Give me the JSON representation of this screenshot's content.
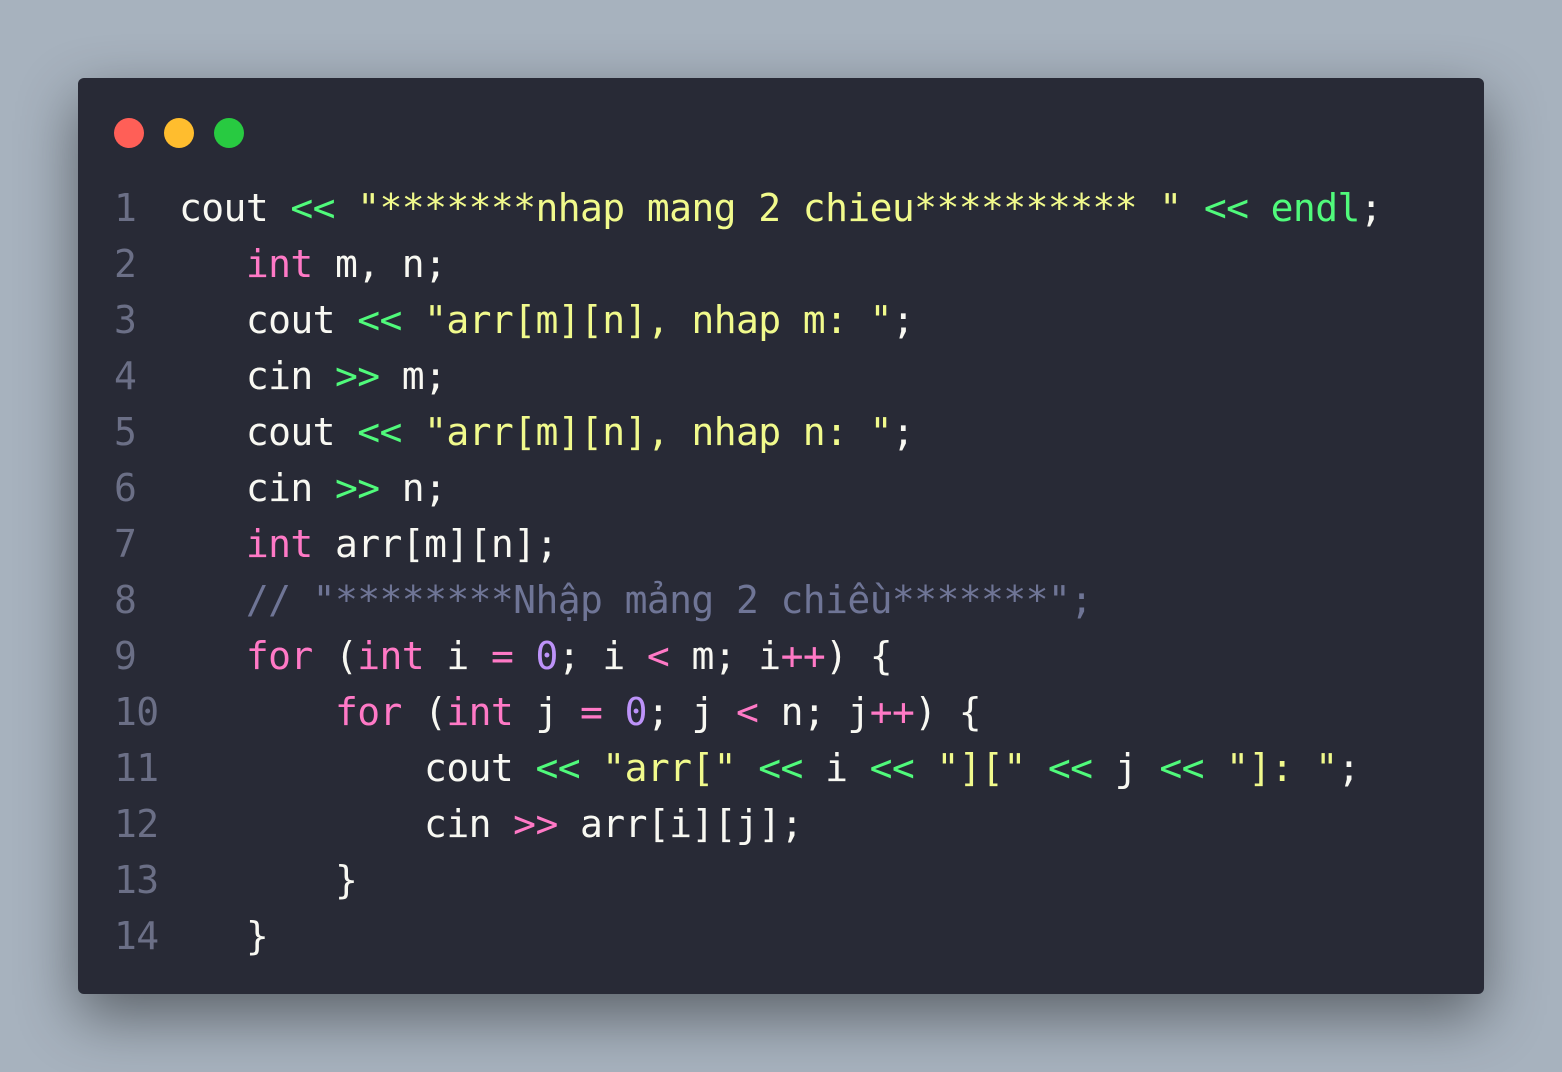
{
  "window": {
    "controls": [
      "close",
      "minimize",
      "maximize"
    ],
    "colors": {
      "close": "#ff5f57",
      "minimize": "#ffbd2e",
      "maximize": "#28ca41",
      "background": "#282a36",
      "page_background": "#a7b2be"
    }
  },
  "code": {
    "lines": [
      {
        "number": "1",
        "tokens": [
          {
            "t": "cout ",
            "c": "plain"
          },
          {
            "t": "<<",
            "c": "op"
          },
          {
            "t": " ",
            "c": "plain"
          },
          {
            "t": "\"*******nhap mang 2 chieu********** \"",
            "c": "str"
          },
          {
            "t": " ",
            "c": "plain"
          },
          {
            "t": "<<",
            "c": "op"
          },
          {
            "t": " ",
            "c": "plain"
          },
          {
            "t": "endl",
            "c": "fn"
          },
          {
            "t": ";",
            "c": "plain"
          }
        ]
      },
      {
        "number": "2",
        "tokens": [
          {
            "t": "   ",
            "c": "plain"
          },
          {
            "t": "int",
            "c": "kw"
          },
          {
            "t": " m, n;",
            "c": "plain"
          }
        ]
      },
      {
        "number": "3",
        "tokens": [
          {
            "t": "   cout ",
            "c": "plain"
          },
          {
            "t": "<<",
            "c": "op"
          },
          {
            "t": " ",
            "c": "plain"
          },
          {
            "t": "\"arr[m][n], nhap m: \"",
            "c": "str"
          },
          {
            "t": ";",
            "c": "plain"
          }
        ]
      },
      {
        "number": "4",
        "tokens": [
          {
            "t": "   cin ",
            "c": "plain"
          },
          {
            "t": ">>",
            "c": "op"
          },
          {
            "t": " m;",
            "c": "plain"
          }
        ]
      },
      {
        "number": "5",
        "tokens": [
          {
            "t": "   cout ",
            "c": "plain"
          },
          {
            "t": "<<",
            "c": "op"
          },
          {
            "t": " ",
            "c": "plain"
          },
          {
            "t": "\"arr[m][n], nhap n: \"",
            "c": "str"
          },
          {
            "t": ";",
            "c": "plain"
          }
        ]
      },
      {
        "number": "6",
        "tokens": [
          {
            "t": "   cin ",
            "c": "plain"
          },
          {
            "t": ">>",
            "c": "op"
          },
          {
            "t": " n;",
            "c": "plain"
          }
        ]
      },
      {
        "number": "7",
        "tokens": [
          {
            "t": "   ",
            "c": "plain"
          },
          {
            "t": "int",
            "c": "kw"
          },
          {
            "t": " arr[m][n];",
            "c": "plain"
          }
        ]
      },
      {
        "number": "8",
        "tokens": [
          {
            "t": "   ",
            "c": "plain"
          },
          {
            "t": "// \"********Nhập mảng 2 chiều*******\";",
            "c": "cmt"
          }
        ]
      },
      {
        "number": "9",
        "tokens": [
          {
            "t": "   ",
            "c": "plain"
          },
          {
            "t": "for",
            "c": "kw"
          },
          {
            "t": " (",
            "c": "plain"
          },
          {
            "t": "int",
            "c": "kw"
          },
          {
            "t": " i ",
            "c": "plain"
          },
          {
            "t": "=",
            "c": "cmp"
          },
          {
            "t": " ",
            "c": "plain"
          },
          {
            "t": "0",
            "c": "num"
          },
          {
            "t": "; i ",
            "c": "plain"
          },
          {
            "t": "<",
            "c": "cmp"
          },
          {
            "t": " m; i",
            "c": "plain"
          },
          {
            "t": "++",
            "c": "cmp"
          },
          {
            "t": ") {",
            "c": "plain"
          }
        ]
      },
      {
        "number": "10",
        "tokens": [
          {
            "t": "       ",
            "c": "plain"
          },
          {
            "t": "for",
            "c": "kw"
          },
          {
            "t": " (",
            "c": "plain"
          },
          {
            "t": "int",
            "c": "kw"
          },
          {
            "t": " j ",
            "c": "plain"
          },
          {
            "t": "=",
            "c": "cmp"
          },
          {
            "t": " ",
            "c": "plain"
          },
          {
            "t": "0",
            "c": "num"
          },
          {
            "t": "; j ",
            "c": "plain"
          },
          {
            "t": "<",
            "c": "cmp"
          },
          {
            "t": " n; j",
            "c": "plain"
          },
          {
            "t": "++",
            "c": "cmp"
          },
          {
            "t": ") {",
            "c": "plain"
          }
        ]
      },
      {
        "number": "11",
        "tokens": [
          {
            "t": "           cout ",
            "c": "plain"
          },
          {
            "t": "<<",
            "c": "op"
          },
          {
            "t": " ",
            "c": "plain"
          },
          {
            "t": "\"arr[\"",
            "c": "str"
          },
          {
            "t": " ",
            "c": "plain"
          },
          {
            "t": "<<",
            "c": "op"
          },
          {
            "t": " i ",
            "c": "plain"
          },
          {
            "t": "<<",
            "c": "op"
          },
          {
            "t": " ",
            "c": "plain"
          },
          {
            "t": "\"][\"",
            "c": "str"
          },
          {
            "t": " ",
            "c": "plain"
          },
          {
            "t": "<<",
            "c": "op"
          },
          {
            "t": " j ",
            "c": "plain"
          },
          {
            "t": "<<",
            "c": "op"
          },
          {
            "t": " ",
            "c": "plain"
          },
          {
            "t": "\"]: \"",
            "c": "str"
          },
          {
            "t": ";",
            "c": "plain"
          }
        ]
      },
      {
        "number": "12",
        "tokens": [
          {
            "t": "           cin ",
            "c": "plain"
          },
          {
            "t": ">>",
            "c": "cmp"
          },
          {
            "t": " arr[i][j];",
            "c": "plain"
          }
        ]
      },
      {
        "number": "13",
        "tokens": [
          {
            "t": "       }",
            "c": "plain"
          }
        ]
      },
      {
        "number": "14",
        "tokens": [
          {
            "t": "   }",
            "c": "plain"
          }
        ]
      }
    ]
  }
}
